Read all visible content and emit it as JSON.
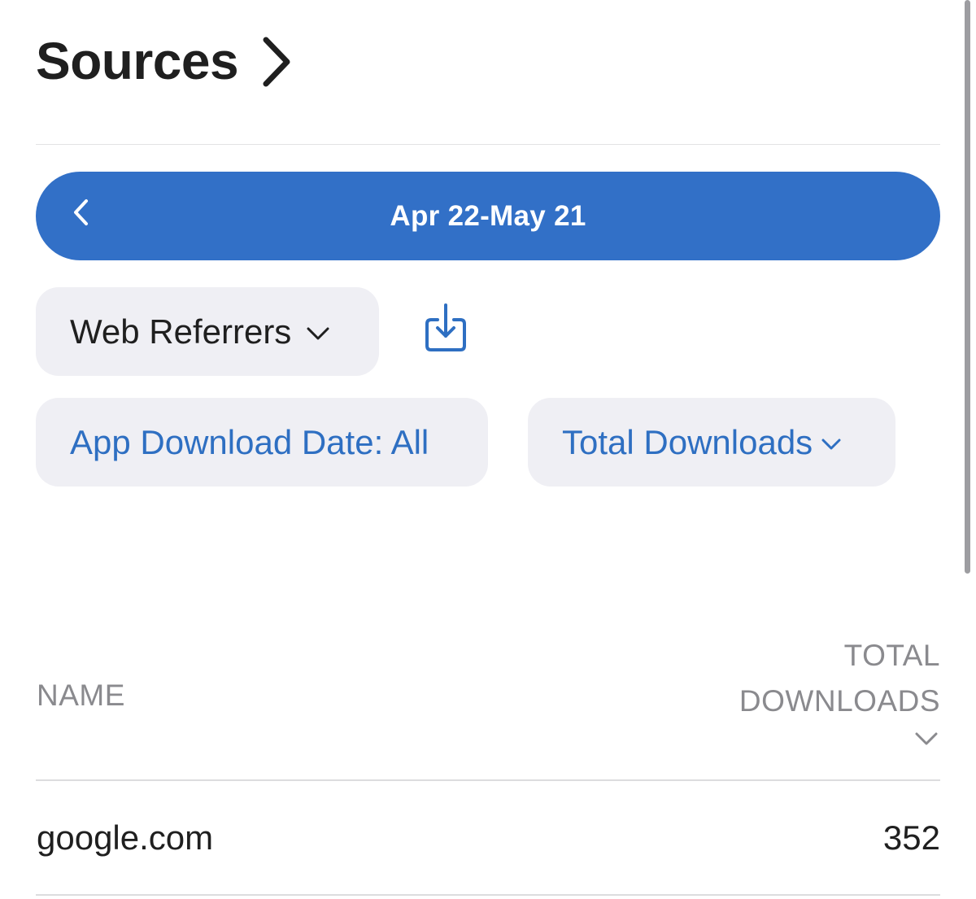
{
  "header": {
    "title": "Sources"
  },
  "date_range": {
    "label": "Apr 22-May 21"
  },
  "filters": {
    "source_type": "Web Referrers",
    "download_date": "App Download Date: All",
    "metric": "Total Downloads"
  },
  "table": {
    "columns": {
      "name": "NAME",
      "total_line1": "TOTAL",
      "total_line2": "DOWNLOADS"
    },
    "rows": [
      {
        "name": "google.com",
        "value": "352"
      }
    ]
  },
  "colors": {
    "accent": "#3270c7",
    "link": "#2e6fc2",
    "pill_bg": "#efeff4"
  },
  "icons": {
    "title_chevron": "chevron-right-icon",
    "date_back": "chevron-left-icon",
    "export": "export-download-icon",
    "sort": "chevron-down-icon"
  }
}
